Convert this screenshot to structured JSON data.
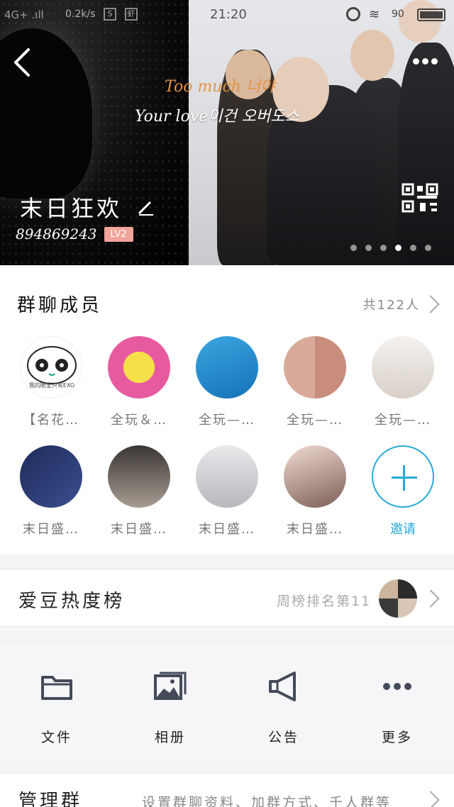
{
  "status_bar": {
    "signal": "4G+ .ıll",
    "speed": "0.2k/s",
    "icon_s": "S",
    "icon_app": "虾",
    "time": "21:20",
    "battery": "90"
  },
  "banner": {
    "lyric_line1": "Too much 너야",
    "lyric_line2": "Your love이건 오버도스",
    "group_name": "末日狂欢",
    "group_id": "894869243",
    "level": "LV2",
    "page_count": 6,
    "active_page": 3
  },
  "members": {
    "title": "群聊成员",
    "count": "共122人",
    "items": [
      {
        "name": "【名花…",
        "avatar_caption": "我的眼里只有EXO"
      },
      {
        "name": "全玩＆…"
      },
      {
        "name": "全玩—…"
      },
      {
        "name": "全玩—…"
      },
      {
        "name": "全玩—…"
      },
      {
        "name": "末日盛…"
      },
      {
        "name": "末日盛…"
      },
      {
        "name": "末日盛…"
      },
      {
        "name": "末日盛…"
      }
    ],
    "invite_label": "邀请"
  },
  "rank": {
    "title": "爱豆热度榜",
    "subtitle": "周榜排名第11"
  },
  "tools": [
    {
      "label": "文件",
      "icon": "folder-icon"
    },
    {
      "label": "相册",
      "icon": "album-icon"
    },
    {
      "label": "公告",
      "icon": "megaphone-icon"
    },
    {
      "label": "更多",
      "icon": "more-dots-icon"
    }
  ],
  "manage": {
    "title": "管理群",
    "subtitle": "设置群聊资料、加群方式、千人群等"
  },
  "colors": {
    "accent": "#27a9d6",
    "level_badge": "#f2a39a",
    "lyric_orange": "#e39447"
  }
}
